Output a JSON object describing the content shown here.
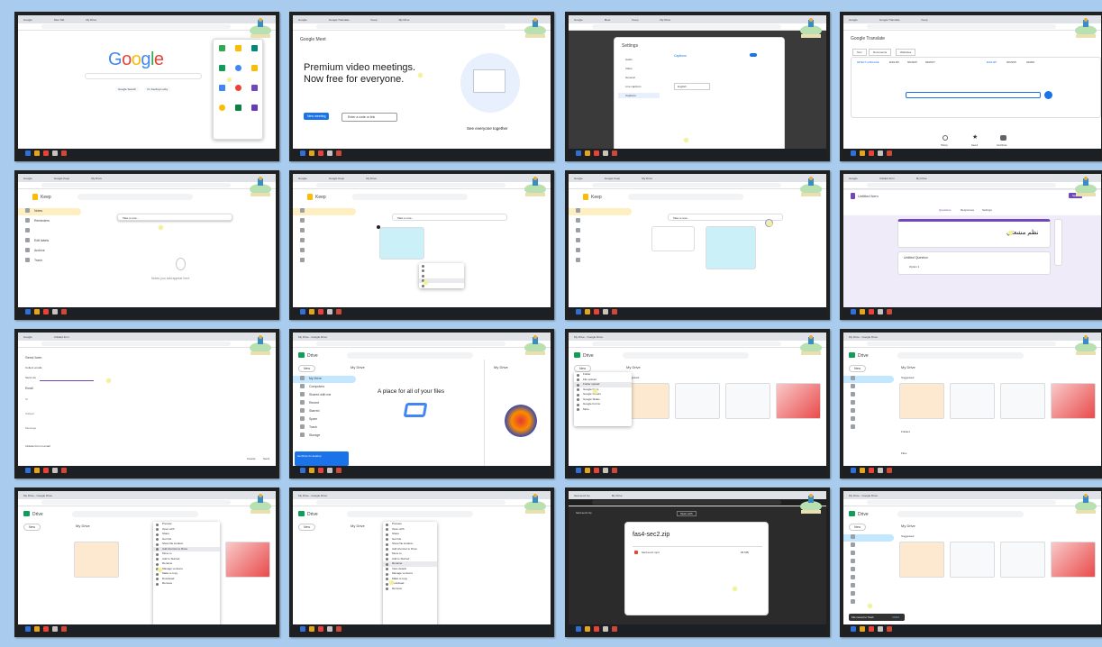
{
  "panels": {
    "p1": {
      "tab": "Google",
      "logo": "Google",
      "btn1": "Google Search",
      "btn2": "I'm Feeling Lucky",
      "apps": [
        "Classroom",
        "Drive",
        "Meet",
        "Sheets",
        "Forms",
        "Keep",
        "Photos"
      ]
    },
    "p2": {
      "app": "Google Meet",
      "headline1": "Premium video meetings.",
      "headline2": "Now free for everyone.",
      "new_meeting": "New meeting",
      "code_placeholder": "Enter a code or link",
      "side_title": "See everyone together"
    },
    "p3": {
      "title": "Settings",
      "items": [
        "Audio",
        "Video",
        "General",
        "Live captions",
        "Captions"
      ],
      "right_title": "Captions",
      "lang": "English"
    },
    "p4": {
      "app": "Google Translate",
      "tabs": [
        "Text",
        "Documents",
        "Websites"
      ],
      "langs": [
        "DETECT LANGUAGE",
        "ENGLISH",
        "SPANISH",
        "FRENCH",
        "ENGLISH",
        "SPANISH",
        "ARABIC"
      ],
      "foot": [
        "History",
        "Saved",
        "Contribute"
      ]
    },
    "p5": {
      "app": "Keep",
      "search": "Search",
      "nav": [
        "Notes",
        "Reminders",
        "Edit labels",
        "Archive",
        "Trash"
      ],
      "take_note": "Take a note...",
      "empty": "Notes you add appear here"
    },
    "p6": {
      "app": "Keep",
      "take_note": "Take a note..."
    },
    "p7": {
      "app": "Keep",
      "take_note": "Take a note..."
    },
    "p8": {
      "title": "Untitled form",
      "tabs": [
        "Questions",
        "Responses",
        "Settings"
      ],
      "send": "Send",
      "heading": "نظم مشعتي",
      "question": "Untitled Question",
      "option": "Option 1"
    },
    "p9": {
      "title": "Send form",
      "collect": "Collect emails",
      "send_via": "Send via",
      "email": "Email",
      "to": "To",
      "subject": "Subject",
      "message": "Message",
      "include": "Include form in email",
      "cancel": "Cancel",
      "send": "Send"
    },
    "p10": {
      "app": "Drive",
      "new": "New",
      "mydrive": "My Drive",
      "heading": "A place for all of your files",
      "side": "My Drive",
      "nav": [
        "My Drive",
        "Computers",
        "Shared with me",
        "Recent",
        "Starred",
        "Spam",
        "Trash",
        "Storage"
      ],
      "get_app": "Get Drive for desktop"
    },
    "p11": {
      "app": "Drive",
      "new": "New",
      "mydrive": "My Drive",
      "suggested": "Suggested",
      "menu": [
        "Folder",
        "File upload",
        "Folder upload",
        "Google Docs",
        "Google Sheets",
        "Google Slides",
        "Google Forms",
        "More"
      ]
    },
    "p12": {
      "app": "Drive",
      "new": "New",
      "mydrive": "My Drive",
      "suggested": "Suggested",
      "folders": "Folders",
      "files": "Files"
    },
    "p13": {
      "app": "Drive",
      "new": "New",
      "mydrive": "My Drive",
      "menu": [
        "Preview",
        "Open with",
        "Share",
        "Get link",
        "Show file location",
        "Add shortcut to Drive",
        "Move to",
        "Add to Starred",
        "Rename",
        "Manage versions",
        "Make a copy",
        "Download",
        "Remove"
      ]
    },
    "p14": {
      "app": "Drive",
      "new": "New",
      "mydrive": "My Drive",
      "menu": [
        "Preview",
        "Open with",
        "Share",
        "Get link",
        "Show file location",
        "Add shortcut to Drive",
        "Move to",
        "Add to Starred",
        "Rename",
        "View details",
        "Manage versions",
        "Make a copy",
        "Download",
        "Remove"
      ]
    },
    "p15": {
      "filename": "fas4-sec2.zip",
      "row_name": "fas4-sec2.mp4",
      "row_size": "96 MB",
      "open_with": "Open with"
    },
    "p16": {
      "app": "Drive",
      "new": "New",
      "mydrive": "My Drive",
      "suggested": "Suggested",
      "snackbar": "File moved to Trash",
      "undo": "UNDO"
    }
  },
  "colors": {
    "frame": "#202020",
    "bg": "#a9ccee",
    "keep_yellow": "#fbbc04",
    "drive_blue": "#1a73e8"
  }
}
